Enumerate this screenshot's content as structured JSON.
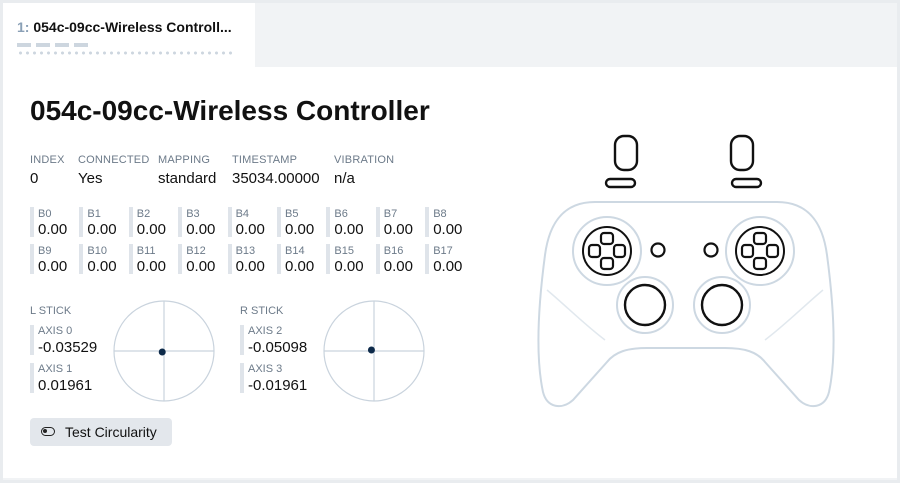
{
  "tab": {
    "index": "1:",
    "title": "054c-09cc-Wireless Controll..."
  },
  "title": "054c-09cc-Wireless Controller",
  "info": [
    {
      "label": "INDEX",
      "value": "0"
    },
    {
      "label": "CONNECTED",
      "value": "Yes"
    },
    {
      "label": "MAPPING",
      "value": "standard"
    },
    {
      "label": "TIMESTAMP",
      "value": "35034.00000"
    },
    {
      "label": "VIBRATION",
      "value": "n/a"
    }
  ],
  "buttons": [
    {
      "label": "B0",
      "value": "0.00"
    },
    {
      "label": "B1",
      "value": "0.00"
    },
    {
      "label": "B2",
      "value": "0.00"
    },
    {
      "label": "B3",
      "value": "0.00"
    },
    {
      "label": "B4",
      "value": "0.00"
    },
    {
      "label": "B5",
      "value": "0.00"
    },
    {
      "label": "B6",
      "value": "0.00"
    },
    {
      "label": "B7",
      "value": "0.00"
    },
    {
      "label": "B8",
      "value": "0.00"
    },
    {
      "label": "B9",
      "value": "0.00"
    },
    {
      "label": "B10",
      "value": "0.00"
    },
    {
      "label": "B11",
      "value": "0.00"
    },
    {
      "label": "B12",
      "value": "0.00"
    },
    {
      "label": "B13",
      "value": "0.00"
    },
    {
      "label": "B14",
      "value": "0.00"
    },
    {
      "label": "B15",
      "value": "0.00"
    },
    {
      "label": "B16",
      "value": "0.00"
    },
    {
      "label": "B17",
      "value": "0.00"
    }
  ],
  "sticks": {
    "left": {
      "label": "L STICK",
      "axes": [
        {
          "label": "AXIS 0",
          "value": "-0.03529"
        },
        {
          "label": "AXIS 1",
          "value": "0.01961"
        }
      ],
      "position": {
        "x": -0.03529,
        "y": 0.01961
      }
    },
    "right": {
      "label": "R STICK",
      "axes": [
        {
          "label": "AXIS 2",
          "value": "-0.05098"
        },
        {
          "label": "AXIS 3",
          "value": "-0.01961"
        }
      ],
      "position": {
        "x": -0.05098,
        "y": -0.01961
      }
    }
  },
  "circularity_button": {
    "label": "Test Circularity",
    "icon": "toggle-icon"
  },
  "colors": {
    "accent_dot": "#0d2a4a",
    "stick_lines": "#c9d3dd",
    "controller_outline": "#cdd8e2"
  }
}
